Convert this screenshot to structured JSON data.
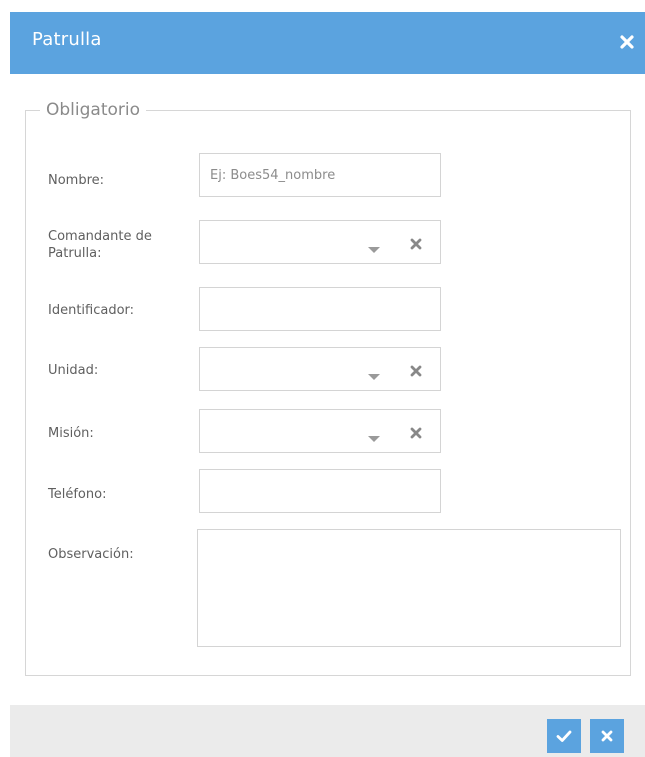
{
  "dialog": {
    "title": "Patrulla",
    "close_icon": "close-icon"
  },
  "group": {
    "legend": "Obligatorio"
  },
  "fields": {
    "nombre": {
      "label": "Nombre:",
      "value": "",
      "placeholder": "Ej: Boes54_nombre"
    },
    "comandante": {
      "label": "Comandante de Patrulla:",
      "value": ""
    },
    "identificador": {
      "label": "Identificador:",
      "value": ""
    },
    "unidad": {
      "label": "Unidad:",
      "value": ""
    },
    "mision": {
      "label": "Misión:",
      "value": ""
    },
    "telefono": {
      "label": "Teléfono:",
      "value": ""
    },
    "observacion": {
      "label": "Observación:",
      "value": ""
    }
  },
  "footer": {
    "accept_icon": "check-icon",
    "cancel_icon": "close-icon"
  },
  "colors": {
    "accent": "#5ba3df",
    "footer_bg": "#ebebeb",
    "border": "#d4d4d4",
    "label_text": "#5f5f5f",
    "legend_text": "#8a8a8a"
  }
}
